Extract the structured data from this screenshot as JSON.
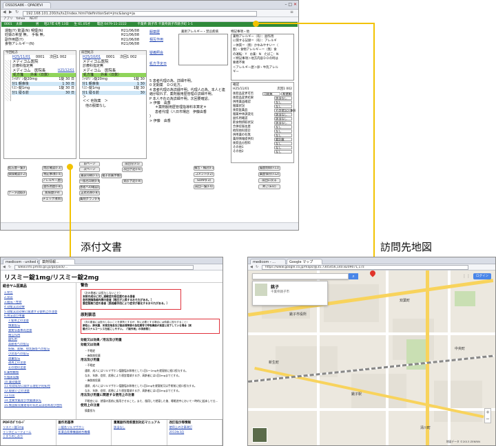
{
  "captions": {
    "package_insert": "添付文書",
    "visit_map": "訪問先地図"
  },
  "top_window": {
    "tab_label": "DSSDSA86 - QPADEVI",
    "address": "192.168.101.200/ts/ts2/index.html?definitionSet=jmc&lang=ja",
    "patient_bar": {
      "id": "0001",
      "name": "太郎",
      "sex": "男",
      "birth": "昭27年 6月 13日",
      "age": "生 61.05才",
      "phone": "電話 0479-11-2222",
      "address": "千葉県 銚子市 千葉県銚子市銚子町 1-1"
    },
    "allergy_list": [
      {
        "label": "運転(Y) 飲酒(N) 喫煙(N)",
        "date": "H21/06/08"
      },
      {
        "label": "妊娠の希望 無。　手帳 無。",
        "date": "H21/06/08"
      },
      {
        "label": "副作用歴(Y)",
        "date": "H21/06/08"
      },
      {
        "label": "食物アレルギー(N)",
        "date": "H21/06/08"
      }
    ],
    "middle_links": [
      "服薬歴",
      "相互作用",
      "疑義照会",
      "初診/再診",
      "処方予定日"
    ],
    "notes_header": "薬剤アレルギー・禁忌疾病",
    "special_notes_header": "特記事項・他",
    "special_notes": [
      "薬物アレルギー（有）：副作用",
      "に関する記録＝（有）：アレルギ",
      "ー体質＝（無）かゆみやすい＝（",
      "無）・食物アレルギー＝（無）食",
      "の運転：Y　お薬：N　たばこ：N",
      "＜特記事項＞地方内容ＤＯの時は",
      "要携不要",
      "＜アレルギー歴＞卵・牛乳アレル",
      "ギー"
    ],
    "prescription_left": {
      "header": "今回処方",
      "date": "H25/11/01",
      "no": "0001",
      "count": "次回1 002",
      "clinic": "メディコム医院",
      "dept": "診療科指定無",
      "clinic2": "メディコム　医院長",
      "date2": "H25/12/01",
      "rx_label": "処方箋",
      "days_label": "外来（日数）",
      "drugs": [
        {
          "name": "ﾌｧﾓﾁｼﾞﾝ錠20mg",
          "qty": "1錠",
          "days": "30",
          "unit": "日"
        },
        {
          "name": "分1 朝食後",
          "qty": "1",
          "days": "30",
          "unit": "日"
        },
        {
          "name": "ﾘｽﾐｰ錠1mg",
          "qty": "1錠",
          "days": "30",
          "unit": "日"
        },
        {
          "name": "分1 寝る前",
          "qty": "",
          "days": "30",
          "unit": "日"
        }
      ]
    },
    "prescription_right": {
      "header": "前回処方",
      "date": "H25/10/01",
      "no": "0001",
      "count": "次回1 002",
      "clinic": "メディコム医院",
      "dept": "診療科指定無",
      "clinic2": "メディコム　医院長",
      "drugs": [
        {
          "name": "ﾌｧﾓﾁｼﾞﾝ錠20mg",
          "qty": "1錠",
          "days": "30"
        },
        {
          "name": "分1 朝食後",
          "qty": "1",
          "days": "30"
        },
        {
          "name": "ﾘｽﾐｰ錠1mg",
          "qty": "1錠",
          "days": "30"
        },
        {
          "name": "分1 寝る前",
          "qty": "",
          "days": "30"
        }
      ],
      "extra": [
        "＞",
        "＜＜ 他院薬　＞",
        "他の服薬なし"
      ]
    },
    "guidance_lines": [
      "5 患者代理の為、詳細不明。",
      "0 定期薬　ＤＯ処方。",
      "4 患者代理の為詳細不明。代理人の為、本人と連",
      "  絡が取れず、薬剤服用歴管理の詳細不明。",
      "P 本人不在の為詳細不明。次回要確認。",
      "> 伊藤　由香",
      "",
      "＊薬剤服用歴管理指導料本算定＊",
      "患者代理（八日市場店　伊藤由香",
      ")",
      "> 伊藤　由香"
    ],
    "check_header": "確認",
    "check_date": "H25/11/01",
    "check_count": "次回1 002",
    "checks": [
      {
        "label": "後発品変更可否",
        "v1": "可能無",
        "v2": "希望無"
      },
      {
        "label": "後発品変更結果",
        "v1": "該当なし",
        "v2": ""
      },
      {
        "label": "併用薬品確認",
        "v1": "なし",
        "v2": ""
      },
      {
        "label": "服薬状況",
        "v1": "なし",
        "v2": ""
      },
      {
        "label": "後発医薬品",
        "v1": "その他ｺﾒﾝﾄ参照",
        "v2": ""
      },
      {
        "label": "服薬中体調変化",
        "v1": "該当なし",
        "v2": ""
      },
      {
        "label": "副作用確認",
        "v1": "該当なし",
        "v2": ""
      },
      {
        "label": "飲食物摂取状況",
        "v1": "該当なし",
        "v2": ""
      },
      {
        "label": "合併症既往歴",
        "v1": "なし",
        "v2": ""
      },
      {
        "label": "他院他科受診",
        "v1": "なし",
        "v2": ""
      },
      {
        "label": "併用薬の有無",
        "v1": "なし",
        "v2": ""
      },
      {
        "label": "薬剤情報提供料",
        "v1": "要記載",
        "v2": ""
      },
      {
        "label": "後発品分割料",
        "v1": "なし",
        "v2": ""
      },
      {
        "label": "その他1",
        "v1": "なし",
        "v2": ""
      },
      {
        "label": "その他2",
        "v1": "なし",
        "v2": ""
      }
    ],
    "buttons_left": [
      "処方歴一覧(F1)",
      "保険確認(F2)",
      "データ読取(F4)"
    ],
    "buttons_mid": [
      "問診確認(F3)",
      "特記事項(F4)",
      "アレルギー歴(F7)",
      "副作用歴(F8)",
      "疾病歴(F9)",
      "チェック項目(F10)"
    ],
    "buttons_mid2": [
      "前ページ",
      "次ページ",
      "薬袋印刷(F5)",
      "一般名印刷(F6)",
      "患者への確認(F7)",
      "正式名称(F8)",
      "薬剤グラフ(F9)"
    ],
    "buttons_mid3": [
      "前回を(F5)",
      "次回予定(F6)",
      "電子お薬手帳(F7)",
      "受診予定(F8)"
    ],
    "buttons_right": [
      "報告・検討(F1)",
      "コメント(F2)",
      "SOAP(F3)",
      "前回一覧(F4)"
    ],
    "buttons_far": [
      "履歴削除(F11)",
      "薬歴保存(F12)",
      "前回に戻る",
      "終了(Esc)"
    ]
  },
  "bottom_left_window": {
    "tab1": "medicom - united notes",
    "tab2": "薬剤情報...",
    "address": "www.info.pmda.go.jp/go/pack/...",
    "title": "リスミー錠1mg/リスミー錠2mg",
    "toc_header": "総合ヤム医薬品",
    "toc": [
      "1.警告",
      "2.禁忌",
      "3.組成・性状",
      "4.効能又は効果",
      "5.効能又は効果に関連する使用上の注意",
      "6.用法及び用量",
      "7.使用上の注意",
      "慎重投与",
      "重要な基本的注意",
      "相互作用",
      "副作用",
      "高齢者への投与",
      "妊婦、産婦、授乳婦等への投与",
      "小児等への投与",
      "過量投与",
      "適用上の注意",
      "その他の注意",
      "8.薬物動態",
      "9.臨床成績",
      "10.薬効薬理",
      "11.有効成分に関する理化学的知見",
      "12.取扱い上の注意",
      "13.包装",
      "14.主要文献及び文献請求先",
      "15.製造販売業者等の氏名又は名称及び住所"
    ],
    "section_warning": "警告",
    "warning_lines": [
      "（次の患者には投与しないこと）",
      "本剤の成分に対し過敏症の既往歴のある患者",
      "急性狭隅角緑内障の患者［眼圧が上昇するおそれがある。］",
      "重症筋無力症の患者［筋弛緩作用により症状が悪化するおそれがある。］"
    ],
    "section_contra": "原則禁忌",
    "contra_lines": [
      "（次の患者には投与しないことを原則とするが、特に必要とする場合には慎重に投与すること）",
      "肺性心、肺気腫、気管支喘息及び脳血管障害の急性期等で呼吸機能が高度に低下している場合［炭",
      "酸ガスナルコーシスを起こしやすい。（「副作用」の項参照）］"
    ],
    "body_lines": [
      "効能又は効果／用法及び用量",
      "効能又は効果",
      "・不眠症",
      "・麻酔前投薬",
      "用法及び用量",
      "・不眠症",
      "通常、成人にはリルマザホン塩酸塩水和物として1回1〜2mgを就寝前に経口投与する。",
      "なお、年齢、症状、疾患により適宜増減するが、高齢者には1回2mgまでとする。",
      "・麻酔前投薬",
      "通常、成人にはリルマザホン塩酸塩水和物として1回2mgを就寝前又は手術前に経口投与する。",
      "なお、年齢、症状、疾患により適宜増減するが、高齢者には1回2mgまでとする。",
      "用法及び用量に関連する使用上の注意",
      "不眠症には、就寝の直前に服用させること。また、服用して就寝した後、睡眠途中において一時的に起床して仕事等をする可能性があるときは服用させないこと。",
      "使用上の注意",
      "慎重投与"
    ],
    "footer_cols": [
      {
        "head": "PDFのﾀﾞｳﾝﾛｰﾄﾞ",
        "lines": [
          "リスミー錠1mg",
          "インタビューフォーム",
          "くすりのしおり"
        ]
      },
      {
        "head": "副作用基準",
        "lines": [
          "一般名リルマザホン",
          "医薬品医療機器総合機構"
        ]
      },
      {
        "head": "重篤副作用疾患別対応マニュアル",
        "lines": [
          "該当なし"
        ]
      },
      {
        "head": "改訂指示等情報",
        "lines": [
          "使用上の注意改訂",
          "2013年3月"
        ]
      }
    ]
  },
  "bottom_right_window": {
    "tab1": "medicom - ...",
    "tab2": "Google マップ",
    "address": "https://www.google.co.jp/maps/@35.7305456,140.8209071,17z",
    "search_placeholder": "",
    "search_card_title": "銚子",
    "search_card_sub": "千葉県銚子市",
    "login_label": "ログイン",
    "place_labels": [
      "銚子駅",
      "銚子市役所",
      "双葉町",
      "新生町",
      "中央町",
      "清川町"
    ],
    "map_copyright": "地図データ ©2013 ZENRIN"
  }
}
